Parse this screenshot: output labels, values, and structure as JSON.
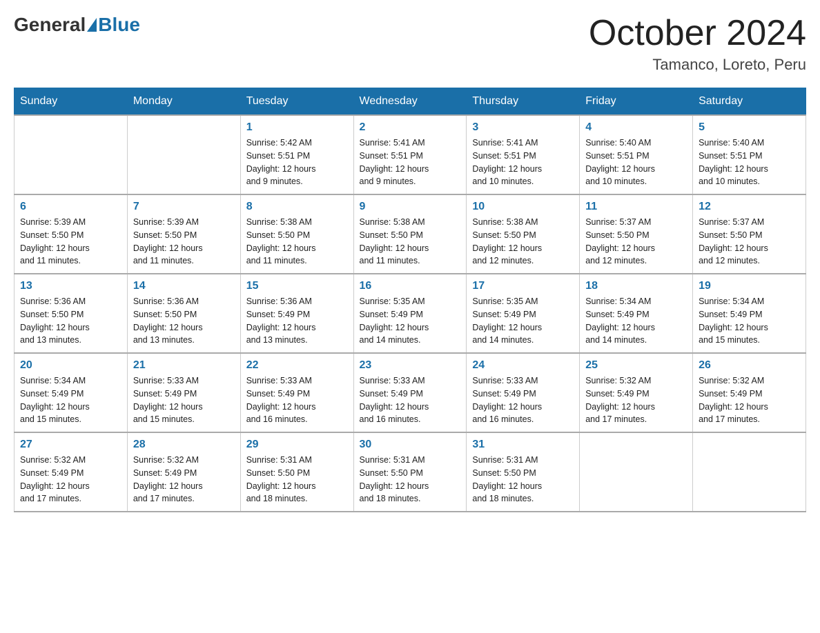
{
  "header": {
    "logo": {
      "general": "General",
      "blue": "Blue"
    },
    "title": "October 2024",
    "location": "Tamanco, Loreto, Peru"
  },
  "days_of_week": [
    "Sunday",
    "Monday",
    "Tuesday",
    "Wednesday",
    "Thursday",
    "Friday",
    "Saturday"
  ],
  "weeks": [
    [
      {
        "day": "",
        "info": ""
      },
      {
        "day": "",
        "info": ""
      },
      {
        "day": "1",
        "info": "Sunrise: 5:42 AM\nSunset: 5:51 PM\nDaylight: 12 hours\nand 9 minutes."
      },
      {
        "day": "2",
        "info": "Sunrise: 5:41 AM\nSunset: 5:51 PM\nDaylight: 12 hours\nand 9 minutes."
      },
      {
        "day": "3",
        "info": "Sunrise: 5:41 AM\nSunset: 5:51 PM\nDaylight: 12 hours\nand 10 minutes."
      },
      {
        "day": "4",
        "info": "Sunrise: 5:40 AM\nSunset: 5:51 PM\nDaylight: 12 hours\nand 10 minutes."
      },
      {
        "day": "5",
        "info": "Sunrise: 5:40 AM\nSunset: 5:51 PM\nDaylight: 12 hours\nand 10 minutes."
      }
    ],
    [
      {
        "day": "6",
        "info": "Sunrise: 5:39 AM\nSunset: 5:50 PM\nDaylight: 12 hours\nand 11 minutes."
      },
      {
        "day": "7",
        "info": "Sunrise: 5:39 AM\nSunset: 5:50 PM\nDaylight: 12 hours\nand 11 minutes."
      },
      {
        "day": "8",
        "info": "Sunrise: 5:38 AM\nSunset: 5:50 PM\nDaylight: 12 hours\nand 11 minutes."
      },
      {
        "day": "9",
        "info": "Sunrise: 5:38 AM\nSunset: 5:50 PM\nDaylight: 12 hours\nand 11 minutes."
      },
      {
        "day": "10",
        "info": "Sunrise: 5:38 AM\nSunset: 5:50 PM\nDaylight: 12 hours\nand 12 minutes."
      },
      {
        "day": "11",
        "info": "Sunrise: 5:37 AM\nSunset: 5:50 PM\nDaylight: 12 hours\nand 12 minutes."
      },
      {
        "day": "12",
        "info": "Sunrise: 5:37 AM\nSunset: 5:50 PM\nDaylight: 12 hours\nand 12 minutes."
      }
    ],
    [
      {
        "day": "13",
        "info": "Sunrise: 5:36 AM\nSunset: 5:50 PM\nDaylight: 12 hours\nand 13 minutes."
      },
      {
        "day": "14",
        "info": "Sunrise: 5:36 AM\nSunset: 5:50 PM\nDaylight: 12 hours\nand 13 minutes."
      },
      {
        "day": "15",
        "info": "Sunrise: 5:36 AM\nSunset: 5:49 PM\nDaylight: 12 hours\nand 13 minutes."
      },
      {
        "day": "16",
        "info": "Sunrise: 5:35 AM\nSunset: 5:49 PM\nDaylight: 12 hours\nand 14 minutes."
      },
      {
        "day": "17",
        "info": "Sunrise: 5:35 AM\nSunset: 5:49 PM\nDaylight: 12 hours\nand 14 minutes."
      },
      {
        "day": "18",
        "info": "Sunrise: 5:34 AM\nSunset: 5:49 PM\nDaylight: 12 hours\nand 14 minutes."
      },
      {
        "day": "19",
        "info": "Sunrise: 5:34 AM\nSunset: 5:49 PM\nDaylight: 12 hours\nand 15 minutes."
      }
    ],
    [
      {
        "day": "20",
        "info": "Sunrise: 5:34 AM\nSunset: 5:49 PM\nDaylight: 12 hours\nand 15 minutes."
      },
      {
        "day": "21",
        "info": "Sunrise: 5:33 AM\nSunset: 5:49 PM\nDaylight: 12 hours\nand 15 minutes."
      },
      {
        "day": "22",
        "info": "Sunrise: 5:33 AM\nSunset: 5:49 PM\nDaylight: 12 hours\nand 16 minutes."
      },
      {
        "day": "23",
        "info": "Sunrise: 5:33 AM\nSunset: 5:49 PM\nDaylight: 12 hours\nand 16 minutes."
      },
      {
        "day": "24",
        "info": "Sunrise: 5:33 AM\nSunset: 5:49 PM\nDaylight: 12 hours\nand 16 minutes."
      },
      {
        "day": "25",
        "info": "Sunrise: 5:32 AM\nSunset: 5:49 PM\nDaylight: 12 hours\nand 17 minutes."
      },
      {
        "day": "26",
        "info": "Sunrise: 5:32 AM\nSunset: 5:49 PM\nDaylight: 12 hours\nand 17 minutes."
      }
    ],
    [
      {
        "day": "27",
        "info": "Sunrise: 5:32 AM\nSunset: 5:49 PM\nDaylight: 12 hours\nand 17 minutes."
      },
      {
        "day": "28",
        "info": "Sunrise: 5:32 AM\nSunset: 5:49 PM\nDaylight: 12 hours\nand 17 minutes."
      },
      {
        "day": "29",
        "info": "Sunrise: 5:31 AM\nSunset: 5:50 PM\nDaylight: 12 hours\nand 18 minutes."
      },
      {
        "day": "30",
        "info": "Sunrise: 5:31 AM\nSunset: 5:50 PM\nDaylight: 12 hours\nand 18 minutes."
      },
      {
        "day": "31",
        "info": "Sunrise: 5:31 AM\nSunset: 5:50 PM\nDaylight: 12 hours\nand 18 minutes."
      },
      {
        "day": "",
        "info": ""
      },
      {
        "day": "",
        "info": ""
      }
    ]
  ]
}
